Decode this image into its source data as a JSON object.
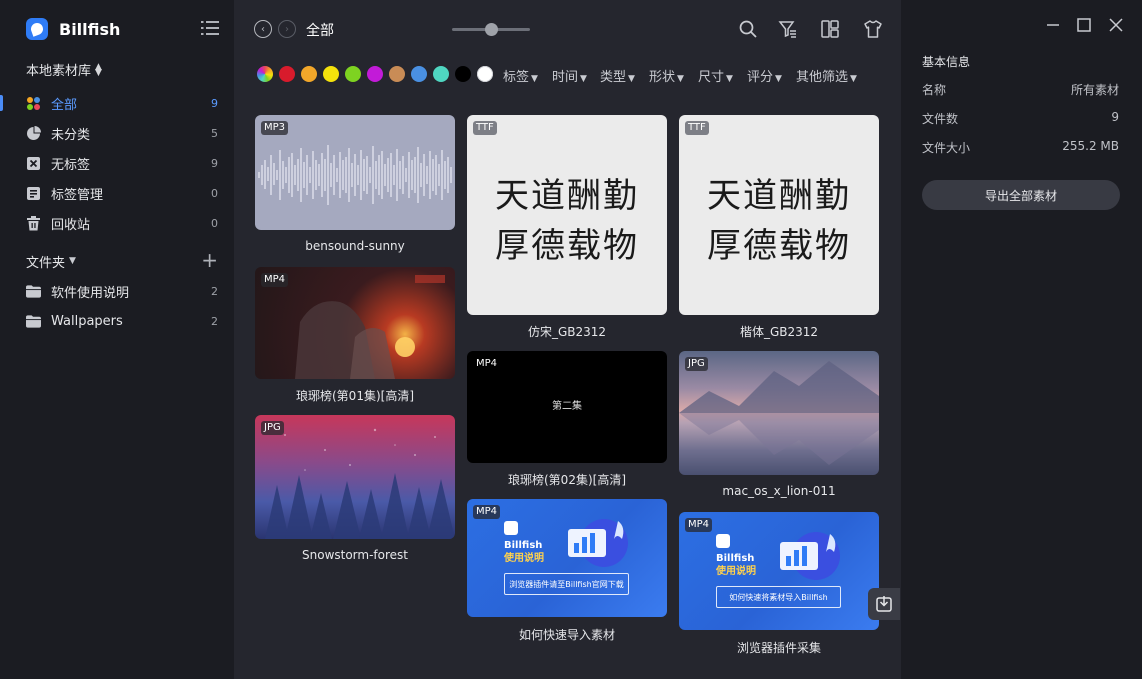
{
  "app": {
    "name": "Billfish"
  },
  "sidebar": {
    "library_title": "本地素材库",
    "nav": [
      {
        "label": "全部",
        "count": "9",
        "icon": "all-icon",
        "active": true
      },
      {
        "label": "未分类",
        "count": "5",
        "icon": "pie-icon"
      },
      {
        "label": "无标签",
        "count": "9",
        "icon": "untagged-icon"
      },
      {
        "label": "标签管理",
        "count": "0",
        "icon": "tag-manage-icon"
      },
      {
        "label": "回收站",
        "count": "0",
        "icon": "trash-icon"
      }
    ],
    "folders_title": "文件夹",
    "folders": [
      {
        "label": "软件使用说明",
        "count": "2",
        "icon": "folder-icon"
      },
      {
        "label": "Wallpapers",
        "count": "2",
        "icon": "folder-icon"
      }
    ]
  },
  "toolbar": {
    "breadcrumb": "全部",
    "zoom_level": 0.5
  },
  "filters": {
    "colors": [
      "rainbow",
      "#d81b2c",
      "#f2a72a",
      "#f5e20c",
      "#7ed321",
      "#c21bd8",
      "#c98c56",
      "#4a90e2",
      "#4fd6c1",
      "#000000",
      "#ffffff"
    ],
    "items": [
      "标签",
      "时间",
      "类型",
      "形状",
      "尺寸",
      "评分",
      "其他筛选"
    ]
  },
  "assets": {
    "bensound": {
      "name": "bensound-sunny",
      "type": "MP3"
    },
    "langya1": {
      "name": "琅琊榜(第01集)[高清]",
      "type": "MP4"
    },
    "snow": {
      "name": "Snowstorm-forest",
      "type": "JPG"
    },
    "fangsong": {
      "name": "仿宋_GB2312",
      "type": "TTF",
      "sample_line1": "天道酬勤",
      "sample_line2": "厚德载物"
    },
    "langya2": {
      "name": "琅琊榜(第02集)[高清]",
      "type": "MP4",
      "overlay": "第二集"
    },
    "import_guide": {
      "name": "如何快速导入素材",
      "type": "MP4",
      "logo_text": "Billfish",
      "title": "使用说明",
      "chip": "浏览器插件请至Billfish官网下载"
    },
    "kaiti": {
      "name": "楷体_GB2312",
      "type": "TTF",
      "sample_line1": "天道酬勤",
      "sample_line2": "厚德载物"
    },
    "lion": {
      "name": "mac_os_x_lion-011",
      "type": "JPG"
    },
    "plugin": {
      "name": "浏览器插件采集",
      "type": "MP4",
      "logo_text": "Billfish",
      "title": "使用说明",
      "chip": "如何快速将素材导入Billfish"
    }
  },
  "info": {
    "title": "基本信息",
    "rows": [
      {
        "key": "名称",
        "value": "所有素材"
      },
      {
        "key": "文件数",
        "value": "9"
      },
      {
        "key": "文件大小",
        "value": "255.2 MB"
      }
    ],
    "export_label": "导出全部素材"
  }
}
